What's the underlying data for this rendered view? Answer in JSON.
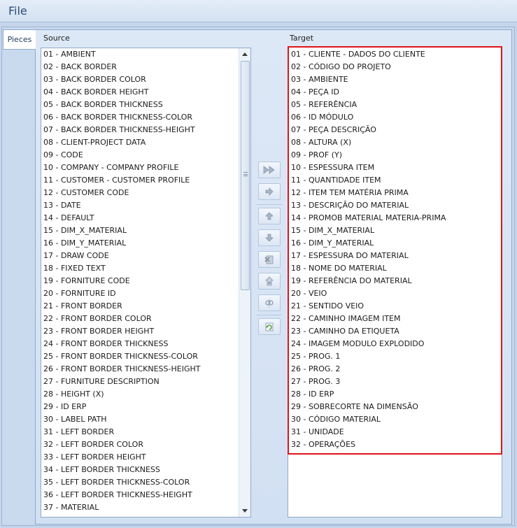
{
  "menu": {
    "file_label": "File"
  },
  "tabs": {
    "pieces_label": "Pieces"
  },
  "source": {
    "label": "Source",
    "items": [
      "01 - AMBIENT",
      "02 - BACK BORDER",
      "03 - BACK BORDER COLOR",
      "04 - BACK BORDER HEIGHT",
      "05 - BACK BORDER THICKNESS",
      "06 - BACK BORDER THICKNESS-COLOR",
      "07 - BACK BORDER THICKNESS-HEIGHT",
      "08 - CLIENT-PROJECT DATA",
      "09 - CODE",
      "10 - COMPANY - COMPANY PROFILE",
      "11 - CUSTOMER - CUSTOMER PROFILE",
      "12 - CUSTOMER CODE",
      "13 - DATE",
      "14 - DEFAULT",
      "15 - DIM_X_MATERIAL",
      "16 - DIM_Y_MATERIAL",
      "17 - DRAW CODE",
      "18 - FIXED TEXT",
      "19 - FORNITURE CODE",
      "20 - FORNITURE ID",
      "21 - FRONT BORDER",
      "22 - FRONT BORDER COLOR",
      "23 - FRONT BORDER HEIGHT",
      "24 - FRONT BORDER THICKNESS",
      "25 - FRONT BORDER THICKNESS-COLOR",
      "26 - FRONT BORDER THICKNESS-HEIGHT",
      "27 - FURNITURE DESCRIPTION",
      "28 - HEIGHT (X)",
      "29 - ID ERP",
      "30 - LABEL PATH",
      "31 - LEFT BORDER",
      "32 - LEFT BORDER COLOR",
      "33 - LEFT BORDER HEIGHT",
      "34 - LEFT BORDER THICKNESS",
      "35 - LEFT BORDER THICKNESS-COLOR",
      "36 - LEFT BORDER THICKNESS-HEIGHT",
      "37 - MATERIAL"
    ]
  },
  "target": {
    "label": "Target",
    "items": [
      "01 - CLIENTE - DADOS DO CLIENTE",
      "02 - CÓDIGO DO PROJETO",
      "03 - AMBIENTE",
      "04 - PEÇA ID",
      "05 - REFERÊNCIA",
      "06 - ID MÓDULO",
      "07 - PEÇA DESCRIÇÃO",
      "08 - ALTURA (X)",
      "09 - PROF (Y)",
      "10 - ESPESSURA ITEM",
      "11 - QUANTIDADE ITEM",
      "12 - ITEM TEM MATÉRIA PRIMA",
      "13 - DESCRIÇÃO DO MATERIAL",
      "14 - PROMOB MATERIAL MATERIA-PRIMA",
      "15 - DIM_X_MATERIAL",
      "16 - DIM_Y_MATERIAL",
      "17 - ESPESSURA DO MATERIAL",
      "18 - NOME DO MATERIAL",
      "19 - REFERÊNCIA DO MATERIAL",
      "20 - VEIO",
      "21 - SENTIDO VEIO",
      "22 - CAMINHO IMAGEM ITEM",
      "23 - CAMINHO DA ETIQUETA",
      "24 - IMAGEM MODULO EXPLODIDO",
      "25 - PROG. 1",
      "26 - PROG. 2",
      "27 - PROG. 3",
      "28 - ID ERP",
      "29 - SOBRECORTE NA DIMENSÃO",
      "30 - CÓDIGO MATERIAL",
      "31 - UNIDADE",
      "32 - OPERAÇÕES"
    ]
  },
  "toolbar": {
    "buttons": [
      "add-all-icon",
      "add-icon",
      "move-up-icon",
      "move-down-icon",
      "delete-icon",
      "edit-icon",
      "link-icon",
      "refresh-icon"
    ]
  },
  "colors": {
    "highlight": "#e0131b",
    "background": "#c5d6ec",
    "panel": "#d2e0f3"
  }
}
